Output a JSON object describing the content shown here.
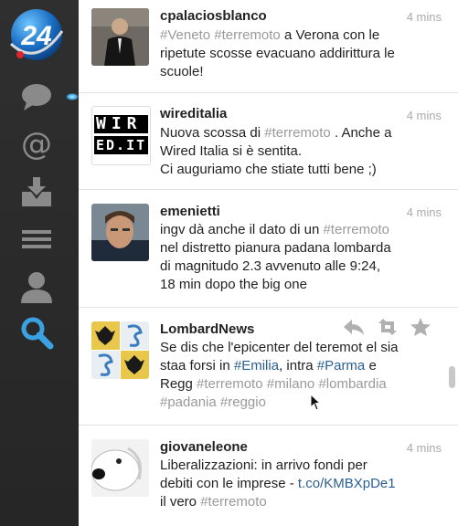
{
  "sidebar": {
    "logo_label": "24",
    "icons": [
      "speech-bubble-icon",
      "at-icon",
      "inbox-download-icon",
      "menu-lines-icon",
      "user-icon",
      "search-icon"
    ],
    "active": "search-icon"
  },
  "colors": {
    "sidebar": "#2a2a2a",
    "hashtag": "#9a9a9a",
    "link": "#2b5f91",
    "active_icon": "#3aa2e2"
  },
  "tweets": [
    {
      "user": "cpalaciosblanco",
      "time": "4 mins",
      "lines": [
        [
          {
            "t": "#Veneto",
            "c": "h"
          },
          {
            "t": " "
          },
          {
            "t": "#terremoto",
            "c": "h"
          },
          {
            "t": " a Verona con le"
          }
        ],
        [
          {
            "t": "ripetute scosse evacuano addirittura le"
          }
        ],
        [
          {
            "t": "scuole!"
          }
        ]
      ]
    },
    {
      "user": "wireditalia",
      "time": "4 mins",
      "avatar_text": [
        "WIR",
        "ED.IT"
      ],
      "lines": [
        [
          {
            "t": "Nuova scossa di "
          },
          {
            "t": "#terremoto",
            "c": "h"
          },
          {
            "t": " . Anche a"
          }
        ],
        [
          {
            "t": "Wired Italia si è sentita."
          }
        ],
        [
          {
            "t": "Ci auguriamo che stiate tutti bene ;)"
          }
        ]
      ]
    },
    {
      "user": "emenietti",
      "time": "4 mins",
      "lines": [
        [
          {
            "t": "ingv dà anche il dato di un "
          },
          {
            "t": "#terremoto",
            "c": "h"
          }
        ],
        [
          {
            "t": "nel distretto pianura padana lombarda"
          }
        ],
        [
          {
            "t": "di magnitudo  2.3 avvenuto alle 9:24,"
          }
        ],
        [
          {
            "t": "18 min dopo the big one"
          }
        ]
      ]
    },
    {
      "user": "LombardNews",
      "time": "",
      "lines": [
        [
          {
            "t": "Se dis che l'epicenter del teremot el sia"
          }
        ],
        [
          {
            "t": "staa forsi in "
          },
          {
            "t": "#Emilia",
            "c": "l"
          },
          {
            "t": ", intra "
          },
          {
            "t": "#Parma",
            "c": "l"
          },
          {
            "t": " e"
          }
        ],
        [
          {
            "t": "Regg "
          },
          {
            "t": "#terremoto",
            "c": "h"
          },
          {
            "t": " "
          },
          {
            "t": "#milano",
            "c": "h"
          },
          {
            "t": " "
          },
          {
            "t": "#lombardia",
            "c": "h"
          }
        ],
        [
          {
            "t": "#padania",
            "c": "h"
          },
          {
            "t": " "
          },
          {
            "t": "#reggio",
            "c": "h"
          }
        ]
      ]
    },
    {
      "user": "giovaneleone",
      "time": "4 mins",
      "lines": [
        [
          {
            "t": "Liberalizzazioni: in arrivo fondi per"
          }
        ],
        [
          {
            "t": "debiti con le imprese - "
          },
          {
            "t": "t.co/KMBXpDe1",
            "c": "l"
          }
        ],
        [
          {
            "t": "il vero "
          },
          {
            "t": "#terremoto",
            "c": "h"
          }
        ]
      ]
    }
  ]
}
